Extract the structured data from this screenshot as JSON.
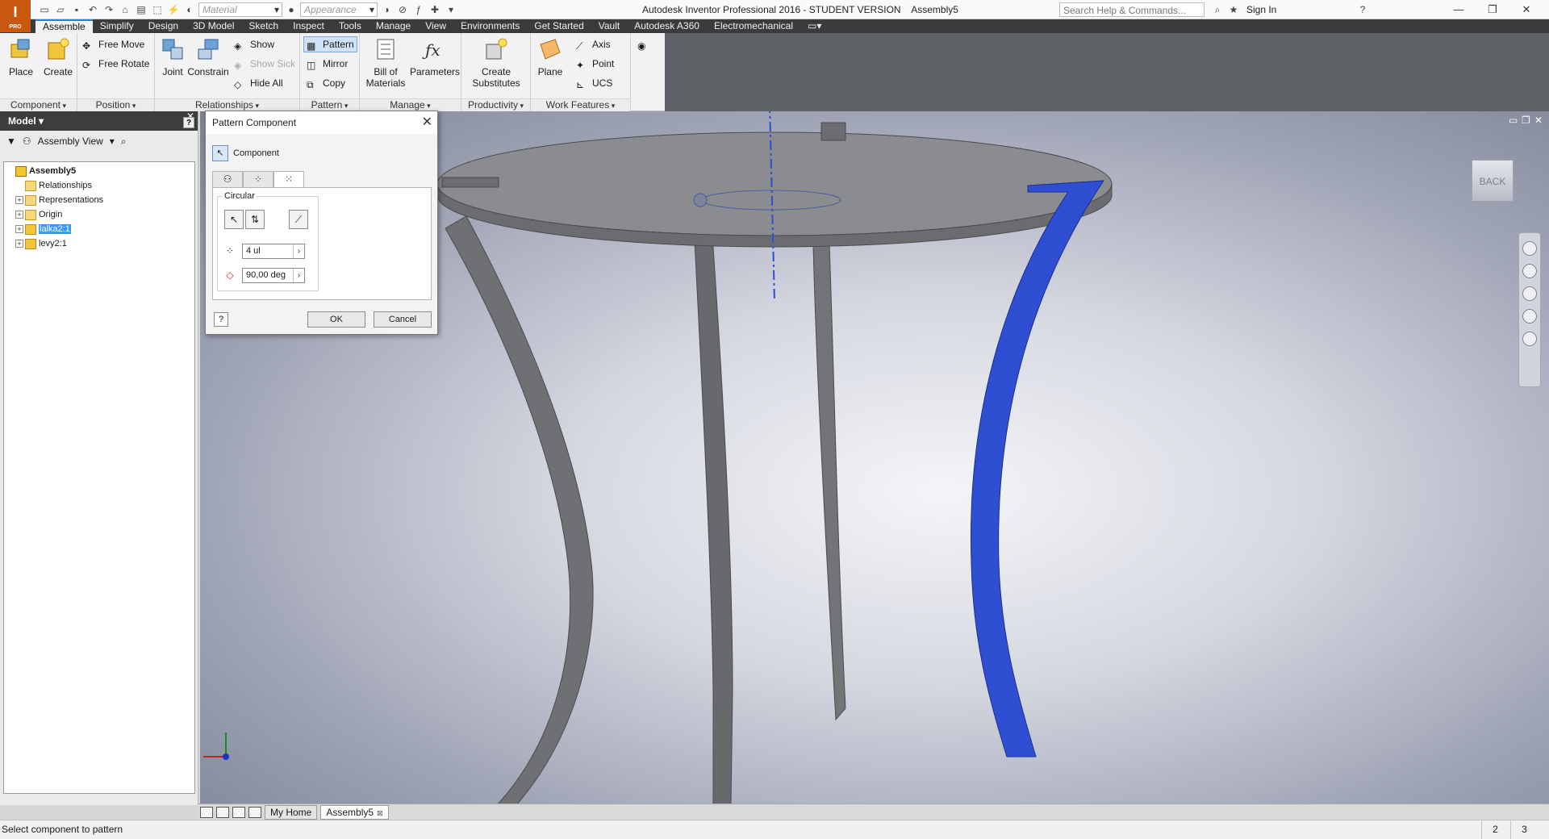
{
  "app": {
    "logo_letter": "I",
    "logo_badge": "PRO",
    "window_title": "Autodesk Inventor Professional 2016 - STUDENT VERSION    Assembly5",
    "search_placeholder": "Search Help & Commands...",
    "signin_label": "Sign In",
    "material_placeholder": "Material",
    "appearance_placeholder": "Appearance"
  },
  "ribbon_tabs": [
    "Assemble",
    "Simplify",
    "Design",
    "3D Model",
    "Sketch",
    "Inspect",
    "Tools",
    "Manage",
    "View",
    "Environments",
    "Get Started",
    "Vault",
    "Autodesk A360",
    "Electromechanical"
  ],
  "ribbon": {
    "component": {
      "label": "Component",
      "place": "Place",
      "create": "Create"
    },
    "position": {
      "label": "Position",
      "free_move": "Free Move",
      "free_rotate": "Free Rotate"
    },
    "relationships": {
      "label": "Relationships",
      "joint": "Joint",
      "constrain": "Constrain",
      "show": "Show",
      "show_sick": "Show Sick",
      "hide_all": "Hide All"
    },
    "pattern": {
      "label": "Pattern",
      "pattern": "Pattern",
      "mirror": "Mirror",
      "copy": "Copy"
    },
    "manage": {
      "label": "Manage",
      "bom_line1": "Bill of",
      "bom_line2": "Materials",
      "parameters": "Parameters"
    },
    "productivity": {
      "label": "Productivity",
      "create_subs_line1": "Create",
      "create_subs_line2": "Substitutes"
    },
    "work_features": {
      "label": "Work Features",
      "plane": "Plane",
      "axis": "Axis",
      "point": "Point",
      "ucs": "UCS"
    }
  },
  "browser": {
    "title": "Model",
    "view_selector": "Assembly View",
    "tree": [
      {
        "label": "Assembly5",
        "expander": "",
        "icon": "root",
        "indent": 0,
        "bold": true,
        "selected": false
      },
      {
        "label": "Relationships",
        "expander": "",
        "icon": "folder",
        "indent": 1,
        "bold": false,
        "selected": false
      },
      {
        "label": "Representations",
        "expander": "+",
        "icon": "folder",
        "indent": 1,
        "bold": false,
        "selected": false
      },
      {
        "label": "Origin",
        "expander": "+",
        "icon": "folder",
        "indent": 1,
        "bold": false,
        "selected": false
      },
      {
        "label": "lalka2:1",
        "expander": "+",
        "icon": "part",
        "indent": 1,
        "bold": false,
        "selected": true
      },
      {
        "label": "levy2:1",
        "expander": "+",
        "icon": "part",
        "indent": 1,
        "bold": false,
        "selected": false
      }
    ]
  },
  "dialog": {
    "title": "Pattern Component",
    "component_label": "Component",
    "group_label": "Circular",
    "count_value": "4 ul",
    "angle_value": "90,00 deg",
    "ok": "OK",
    "cancel": "Cancel",
    "help": "?"
  },
  "viewport": {
    "viewcube_label": "BACK",
    "highlight_color": "#2f4fd2",
    "part_color": "#6f7073"
  },
  "doc_tabs": {
    "home": "My Home",
    "assembly": "Assembly5"
  },
  "status": {
    "message": "Select component to pattern",
    "count_a": "2",
    "count_b": "3"
  },
  "colors": {
    "ribbon_tab_bg": "#3b3b3b",
    "accent": "#2f7fd0",
    "logo": "#c9580e"
  }
}
